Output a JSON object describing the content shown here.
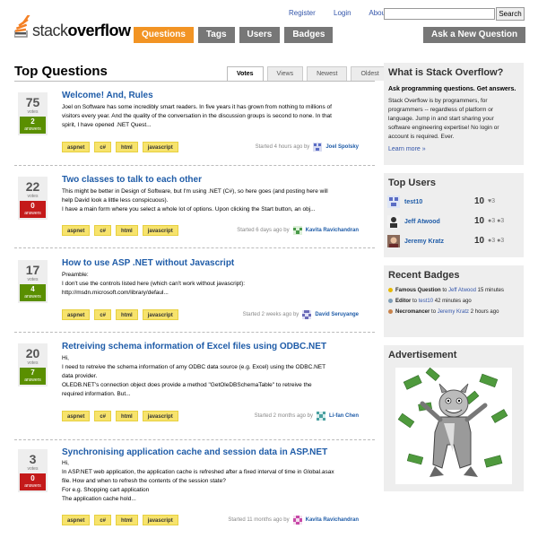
{
  "header": {
    "links": [
      "Register",
      "Login",
      "About"
    ],
    "search_placeholder": "",
    "search_button": "Search",
    "logo": {
      "part1": "stack",
      "part2": "overflow"
    },
    "nav": [
      {
        "label": "Questions",
        "active": true
      },
      {
        "label": "Tags",
        "active": false
      },
      {
        "label": "Users",
        "active": false
      },
      {
        "label": "Badges",
        "active": false
      }
    ],
    "ask_button": "Ask a New Question"
  },
  "main": {
    "title": "Top Questions",
    "sort_tabs": [
      {
        "label": "Votes",
        "active": true
      },
      {
        "label": "Views",
        "active": false
      },
      {
        "label": "Newest",
        "active": false
      },
      {
        "label": "Oldest",
        "active": false
      }
    ],
    "questions": [
      {
        "votes": "75",
        "votes_label": "votes",
        "answers": "2",
        "answers_label": "answers",
        "answer_status": "green",
        "title": "Welcome! And, Rules",
        "excerpt": [
          "Joel on Software has some incredibly smart readers. In five years it has grown from nothing to millions of",
          "visitors every year. And the quality of the conversation in the discussion groups is second to none. In that",
          "spirit, I have opened .NET Quest..."
        ],
        "tags": [
          "aspnet",
          "c#",
          "html",
          "javascript"
        ],
        "started": "Started 4 hours ago by",
        "user": "Joel Spolsky",
        "avatar_color": "#5b6dc4"
      },
      {
        "votes": "22",
        "votes_label": "votes",
        "answers": "0",
        "answers_label": "answers",
        "answer_status": "red",
        "title": "Two classes to talk to each other",
        "excerpt": [
          "This might be better in Design of Software, but I'm using .NET (C#), so here goes (and posting here will",
          "help David look a little less conspicuous).",
          "I have a main form where you select a whole lot of options. Upon clicking the Start button, an obj..."
        ],
        "tags": [
          "aspnet",
          "c#",
          "html",
          "javascript"
        ],
        "started": "Started 6 days ago by",
        "user": "Kavita Ravichandran",
        "avatar_color": "#4a9a4a"
      },
      {
        "votes": "17",
        "votes_label": "votes",
        "answers": "4",
        "answers_label": "answers",
        "answer_status": "green",
        "title": "How to use ASP .NET without Javascript",
        "excerpt": [
          "Preamble:",
          "I don't use the controls listed here (which can't work without javascript):",
          "http://msdn.microsoft.com/library/defaul..."
        ],
        "tags": [
          "aspnet",
          "c#",
          "html",
          "javascript"
        ],
        "started": "Started 2 weeks ago by",
        "user": "David Seruyange",
        "avatar_color": "#6a6ab8"
      },
      {
        "votes": "20",
        "votes_label": "votes",
        "answers": "7",
        "answers_label": "answers",
        "answer_status": "green",
        "title": "Retreiving schema information of Excel files using ODBC.NET",
        "excerpt": [
          "Hi,",
          "I need to retreive the schema information of amy ODBC data source (e.g. Excel) using the ODBC.NET",
          "data provider.",
          "OLEDB.NET's connection object does provide a method \"GetOleDBSchemaTable\" to retreive the",
          "required information. But..."
        ],
        "tags": [
          "aspnet",
          "c#",
          "html",
          "javascript"
        ],
        "started": "Started 2 months ago by",
        "user": "Li-fan Chen",
        "avatar_color": "#4aa0a0"
      },
      {
        "votes": "3",
        "votes_label": "votes",
        "answers": "0",
        "answers_label": "answers",
        "answer_status": "red",
        "title": "Synchronising application cache and session data in ASP.NET",
        "excerpt": [
          "Hi,",
          "In ASP.NET web application, the application cache is refreshed after a fixed interval of time in Global.asax",
          "file. How and when to refresh the contents of the session state?",
          "For e.g. Shopping cart application",
          "The application cache hold..."
        ],
        "tags": [
          "aspnet",
          "c#",
          "html",
          "javascript"
        ],
        "started": "Started 11 months ago by",
        "user": "Kavita Ravichandran",
        "avatar_color": "#c84aa8"
      }
    ]
  },
  "sidebar": {
    "about": {
      "heading": "What is Stack Overflow?",
      "strong": "Ask programming questions. Get answers.",
      "text": [
        "Stack Overflow is by programmers, for",
        "programmers -- regardless of platform or",
        "language. Jump in and start sharing your",
        "software engineering expertise! No login or",
        "account is required. Ever."
      ],
      "more": "Learn more »"
    },
    "top_users": {
      "heading": "Top Users",
      "users": [
        {
          "name": "test10",
          "rep": "10",
          "badges": "♥3",
          "badge_colors": [
            "#7f9eb8"
          ]
        },
        {
          "name": "Jeff Atwood",
          "rep": "10",
          "badges": "●3 ●3",
          "badge_colors": [
            "#e6b800",
            "#c8824a"
          ]
        },
        {
          "name": "Jeremy Kratz",
          "rep": "10",
          "badges": "●3 ●3",
          "badge_colors": [
            "#7f9eb8",
            "#c8824a"
          ]
        }
      ]
    },
    "recent_badges": {
      "heading": "Recent Badges",
      "items": [
        {
          "badge": "Famous Question",
          "to": "to",
          "who": "Jeff Atwood",
          "when": "15 minutes",
          "type": "gold"
        },
        {
          "badge": "Editor",
          "to": "to",
          "who": "test10",
          "when": "42 minutes ago",
          "type": "silver"
        },
        {
          "badge": "Necromancer",
          "to": "to",
          "who": "Jeremy Kratz",
          "when": "2 hours ago",
          "type": "bronze"
        }
      ]
    },
    "ad": {
      "heading": "Advertisement"
    }
  }
}
